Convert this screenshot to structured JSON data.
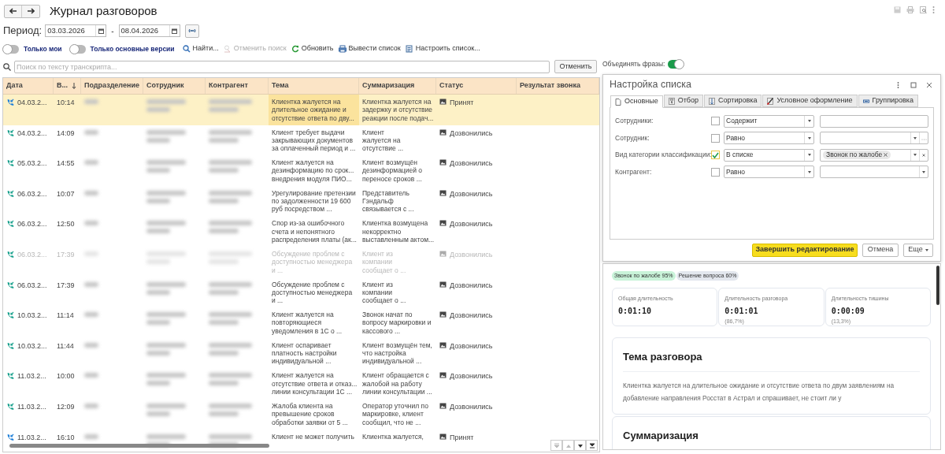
{
  "window": {
    "title": "Журнал разговоров"
  },
  "period": {
    "label": "Период:",
    "from": "03.03.2026",
    "separator": "-",
    "to": "08.04.2026"
  },
  "toggles": [
    {
      "label": "Только мои",
      "on": false
    },
    {
      "label": "Только основные версии",
      "on": false
    }
  ],
  "toolbar": [
    {
      "label": "Найти...",
      "kind": "search",
      "disabled": false
    },
    {
      "label": "Отменить поиск",
      "kind": "cancel",
      "disabled": true
    },
    {
      "label": "Обновить",
      "kind": "refresh",
      "disabled": false
    },
    {
      "label": "Вывести список",
      "kind": "print",
      "disabled": false
    },
    {
      "label": "Настроить список...",
      "kind": "settings",
      "disabled": false
    }
  ],
  "search": {
    "placeholder": "Поиск по тексту транскрипта...",
    "button": "Отменить"
  },
  "merge_phrases": {
    "label": "Объединять фразы:",
    "on": true
  },
  "table": {
    "columns": [
      {
        "label": "Дата",
        "sorted": false
      },
      {
        "label": "В...",
        "sorted": true
      },
      {
        "label": "Подразделение",
        "sorted": false
      },
      {
        "label": "Сотрудник",
        "sorted": false
      },
      {
        "label": "Контрагент",
        "sorted": false
      },
      {
        "label": "Тема",
        "sorted": false
      },
      {
        "label": "Суммаризация",
        "sorted": false
      },
      {
        "label": "Статус",
        "sorted": false
      },
      {
        "label": "Результат звонка",
        "sorted": false
      }
    ],
    "rows": [
      {
        "date": "04.03.2...",
        "time": "10:14",
        "topic": "Клиентка жалуется на\nдлительное ожидание и\nотсутствие ответа по дву...",
        "summary": "Клиентка жалуется на\nзадержку и отсутствие\nреакции после подач...",
        "status": "Принят",
        "color": "#1e7fd8",
        "selected": true,
        "dimmed": false
      },
      {
        "date": "04.03.2...",
        "time": "14:09",
        "topic": "Клиент требует выдачи\nзакрывающих документов\nза оплаченный период и ...",
        "summary": "Клиент\nжалуется на\nотсутствие ...",
        "status": "Дозвонились",
        "color": "#17a08c",
        "selected": false,
        "dimmed": false
      },
      {
        "date": "05.03.2...",
        "time": "14:55",
        "topic": "Клиент жалуется на\nдезинформацию по срок...\nвнедрения модуля ПИО...",
        "summary": "Клиент возмущён\nдезинформацией о\nпереносе сроков ...",
        "status": "Дозвонились",
        "color": "#17a08c",
        "selected": false,
        "dimmed": false
      },
      {
        "date": "06.03.2...",
        "time": "10:07",
        "topic": "Урегулирование претензии\nпо задолженности 19 600\nруб посредством ...",
        "summary": "Представитель\nГэндальф\nсвязывается с ...",
        "status": "Дозвонились",
        "color": "#17a08c",
        "selected": false,
        "dimmed": false
      },
      {
        "date": "06.03.2...",
        "time": "12:50",
        "topic": "Спор из-за ошибочного\nсчета и непонятного\nраспределения платы (ак...",
        "summary": "Клиентка возмущена\nнекорректно\nвыставленным актом...",
        "status": "Дозвонились",
        "color": "#17a08c",
        "selected": false,
        "dimmed": false
      },
      {
        "date": "06.03.2...",
        "time": "17:39",
        "topic": "Обсуждение проблем с\nдоступностью менеджера\nи ...",
        "summary": "Клиент из\nкомпании\nсообщает о ...",
        "status": "Дозвонились",
        "color": "#17a08c",
        "selected": false,
        "dimmed": true
      },
      {
        "date": "06.03.2...",
        "time": "17:39",
        "topic": "Обсуждение проблем с\nдоступностью менеджера\nи ...",
        "summary": "Клиент из\nкомпании\nсообщает о ...",
        "status": "Дозвонились",
        "color": "#17a08c",
        "selected": false,
        "dimmed": false
      },
      {
        "date": "10.03.2...",
        "time": "11:14",
        "topic": "Клиент жалуется на\nповторяющиеся\nуведомления в 1С о ...",
        "summary": "Звонок начат по\nвопросу маркировки и\nкассового ...",
        "status": "Дозвонились",
        "color": "#17a08c",
        "selected": false,
        "dimmed": false
      },
      {
        "date": "10.03.2...",
        "time": "11:44",
        "topic": "Клиент оспаривает\nплатность настройки\nиндивидуальной ...",
        "summary": "Клиент возмущён тем,\nчто настройка\nиндивидуальной ...",
        "status": "Дозвонились",
        "color": "#17a08c",
        "selected": false,
        "dimmed": false
      },
      {
        "date": "11.03.2...",
        "time": "10:00",
        "topic": "Клиент жалуется на\nотсутствие ответа и отказ...\nлинии консультации 1С ...",
        "summary": "Клиент обращается с\nжалобой на работу\nлинии консультации ...",
        "status": "Дозвонились",
        "color": "#17a08c",
        "selected": false,
        "dimmed": false
      },
      {
        "date": "11.03.2...",
        "time": "12:09",
        "topic": "Жалоба клиента на\nпревышение сроков\nобработки заявки от 5 ...",
        "summary": "Оператор уточнил по\nмаркировке, клиент\nсообщил, что не ...",
        "status": "Дозвонились",
        "color": "#17a08c",
        "selected": false,
        "dimmed": false
      },
      {
        "date": "11.03.2...",
        "time": "16:10",
        "topic": "Клиент не может получить",
        "summary": "Клиентка жалуется,",
        "status": "Принят",
        "color": "#1e7fd8",
        "selected": false,
        "dimmed": false
      }
    ]
  },
  "dialog": {
    "title": "Настройка списка",
    "tabs": [
      {
        "label": "Основные",
        "kind": "main",
        "selected": true
      },
      {
        "label": "Отбор",
        "kind": "filter",
        "selected": false
      },
      {
        "label": "Сортировка",
        "kind": "sort",
        "selected": false
      },
      {
        "label": "Условное оформление",
        "kind": "format",
        "selected": false
      },
      {
        "label": "Группировка",
        "kind": "group",
        "selected": false
      }
    ],
    "filters": [
      {
        "label": "Сотрудники:",
        "checked": false,
        "condition": "Содержит",
        "kind": "text"
      },
      {
        "label": "Сотрудник:",
        "checked": false,
        "condition": "Равно",
        "kind": "pick"
      },
      {
        "label": "Вид категории классификации:",
        "checked": true,
        "condition": "В списке",
        "kind": "list",
        "tag": "Звонок по жалобе"
      },
      {
        "label": "Контрагент:",
        "checked": false,
        "condition": "Равно",
        "kind": "select"
      }
    ],
    "buttons": [
      {
        "label": "Завершить редактирование",
        "kind": "primary"
      },
      {
        "label": "Отмена",
        "kind": "plain"
      },
      {
        "label": "Еще",
        "kind": "menu"
      }
    ]
  },
  "details": {
    "tags": [
      {
        "label": "Звонок по жалобе 95%",
        "color": "#c9f3d9"
      },
      {
        "label": "Решение вопроса 60%",
        "color": "#e3e7ee"
      }
    ],
    "stats": [
      {
        "label": "Общая длительность",
        "value": "0:01:10"
      },
      {
        "label": "Длительность разговора",
        "value": "0:01:01",
        "share": "(86,7%)"
      },
      {
        "label": "Длительность тишины",
        "value": "0:00:09",
        "share": "(13,3%)"
      }
    ],
    "sections": [
      {
        "title": "Тема разговора",
        "text": "Клиентка жалуется на длительное ожидание и отсутствие ответа по двум заявлениям на добавление направления Росстат в Астрал и спрашивает, не стоит ли у"
      },
      {
        "title": "Суммаризация"
      }
    ]
  }
}
